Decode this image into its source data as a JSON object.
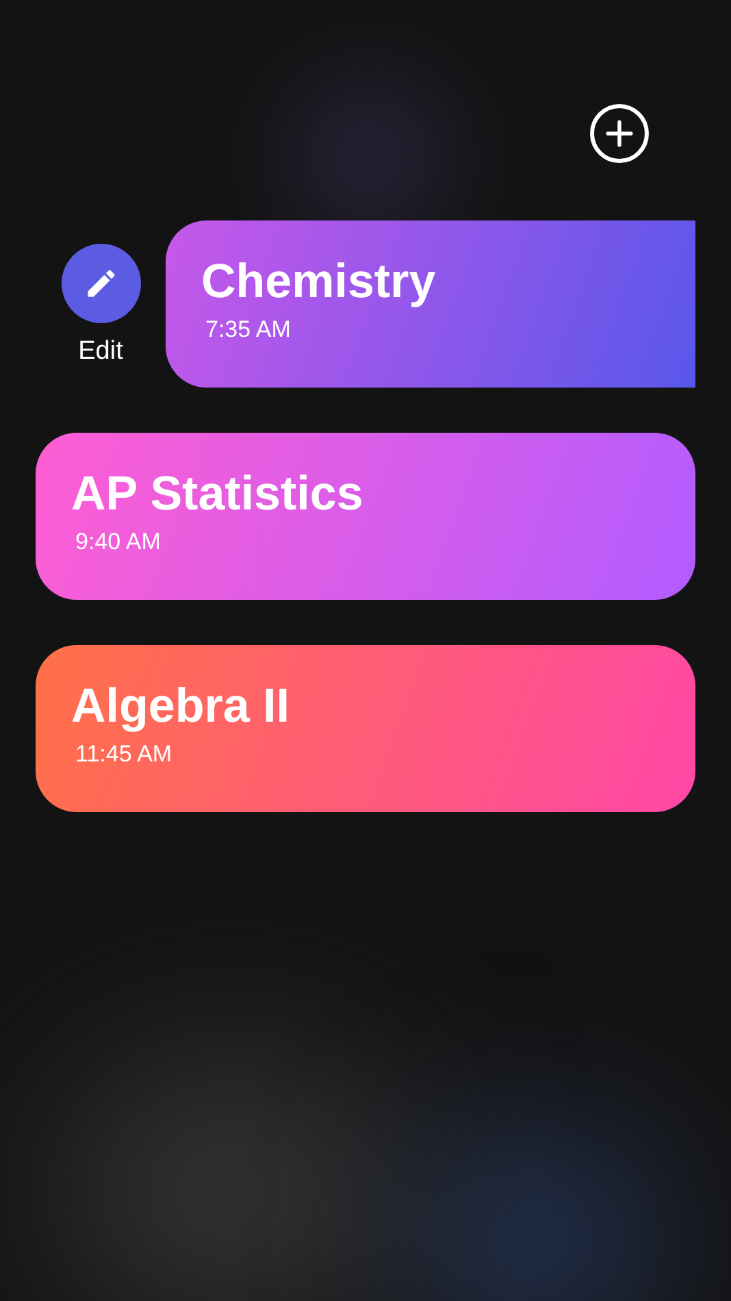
{
  "classes": [
    {
      "title": "Chemistry",
      "time": "7:35 AM",
      "swiped": true,
      "action": "Edit",
      "color": "#c758ea"
    },
    {
      "title": "AP Statistics",
      "time": "9:40 AM",
      "swiped": false,
      "color": "#ff5ed3"
    },
    {
      "title": "Algebra II",
      "time": "11:45 AM",
      "swiped": false,
      "color": "#ff7147"
    }
  ]
}
